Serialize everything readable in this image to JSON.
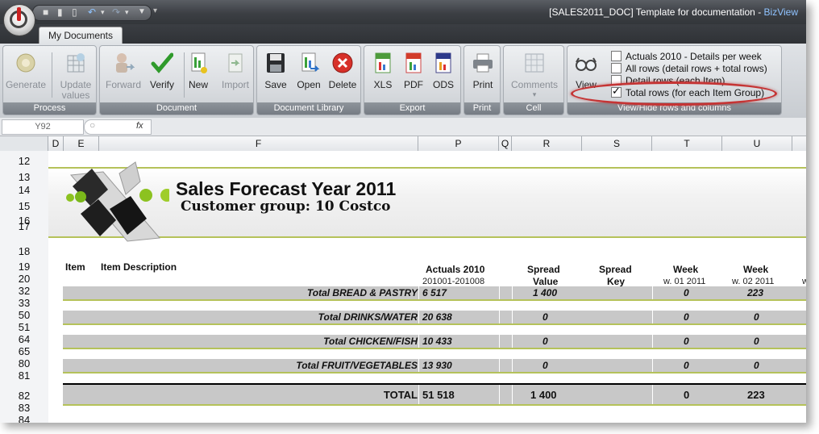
{
  "window": {
    "title_doc": "[SALES2011_DOC] Template for documentation - ",
    "title_app": "BizView"
  },
  "tabs": [
    {
      "label": "My Documents"
    }
  ],
  "ribbon": {
    "groups": [
      {
        "label": "Process",
        "buttons": [
          {
            "label": "Generate",
            "icon": "generate-icon"
          },
          {
            "label": "Update\nvalues",
            "icon": "update-values-icon"
          }
        ]
      },
      {
        "label": "Document",
        "buttons": [
          {
            "label": "Forward",
            "icon": "forward-icon"
          },
          {
            "label": "Verify",
            "icon": "check-icon"
          },
          {
            "label": "New",
            "icon": "new-document-icon"
          },
          {
            "label": "Import",
            "icon": "import-icon"
          }
        ]
      },
      {
        "label": "Document Library",
        "buttons": [
          {
            "label": "Save",
            "icon": "floppy-icon"
          },
          {
            "label": "Open",
            "icon": "open-icon"
          },
          {
            "label": "Delete",
            "icon": "delete-icon"
          }
        ]
      },
      {
        "label": "Export",
        "buttons": [
          {
            "label": "XLS",
            "icon": "xls-icon"
          },
          {
            "label": "PDF",
            "icon": "pdf-icon"
          },
          {
            "label": "ODS",
            "icon": "ods-icon"
          }
        ]
      },
      {
        "label": "Print",
        "buttons": [
          {
            "label": "Print",
            "icon": "printer-icon"
          }
        ]
      },
      {
        "label": "Cell",
        "buttons": [
          {
            "label": "Comments",
            "icon": "comments-icon"
          }
        ]
      },
      {
        "label": "View/Hide rows and columns",
        "buttons": [
          {
            "label": "View",
            "icon": "glasses-icon"
          }
        ]
      }
    ],
    "view_options": [
      {
        "label": "Actuals 2010 - Details per week",
        "checked": false
      },
      {
        "label": "All rows (detail rows + total rows)",
        "checked": false
      },
      {
        "label": "Detail rows (each Item)",
        "checked": false
      },
      {
        "label": "Total rows (for each Item Group)",
        "checked": true
      }
    ]
  },
  "formula_bar": {
    "name_box": "Y92",
    "fx": "fx"
  },
  "columns": [
    "D",
    "E",
    "F",
    "P",
    "Q",
    "R",
    "S",
    "T",
    "U"
  ],
  "rows": [
    "12",
    "13",
    "14",
    "15",
    "16",
    "17",
    "18",
    "19",
    "20",
    "32",
    "33",
    "50",
    "51",
    "64",
    "65",
    "80",
    "81",
    "82",
    "83",
    "84"
  ],
  "report": {
    "title": "Sales Forecast Year 2011",
    "subtitle": "Customer group: 10 Costco",
    "headers": {
      "item": "Item",
      "item_desc": "Item Description",
      "actuals": "Actuals 2010",
      "actuals_sub": "201001-201008",
      "spread_value_1": "Spread",
      "spread_value_2": "Value",
      "spread_key_1": "Spread",
      "spread_key_2": "Key",
      "week_t": "Week",
      "week_t_sub": "w. 01 2011",
      "week_u": "Week",
      "week_u_sub": "w. 02 2011",
      "week_next_sub": "w"
    },
    "totals": [
      {
        "label": "Total BREAD & PASTRY",
        "actuals": "6 517",
        "spread": "1 400",
        "w1": "0",
        "w2": "223"
      },
      {
        "label": "Total DRINKS/WATER",
        "actuals": "20 638",
        "spread": "0",
        "w1": "0",
        "w2": "0"
      },
      {
        "label": "Total CHICKEN/FISH",
        "actuals": "10 433",
        "spread": "0",
        "w1": "0",
        "w2": "0"
      },
      {
        "label": "Total FRUIT/VEGETABLES",
        "actuals": "13 930",
        "spread": "0",
        "w1": "0",
        "w2": "0"
      }
    ],
    "grand_total": {
      "label": "TOTAL",
      "actuals": "51 518",
      "spread": "1 400",
      "w1": "0",
      "w2": "223"
    }
  }
}
